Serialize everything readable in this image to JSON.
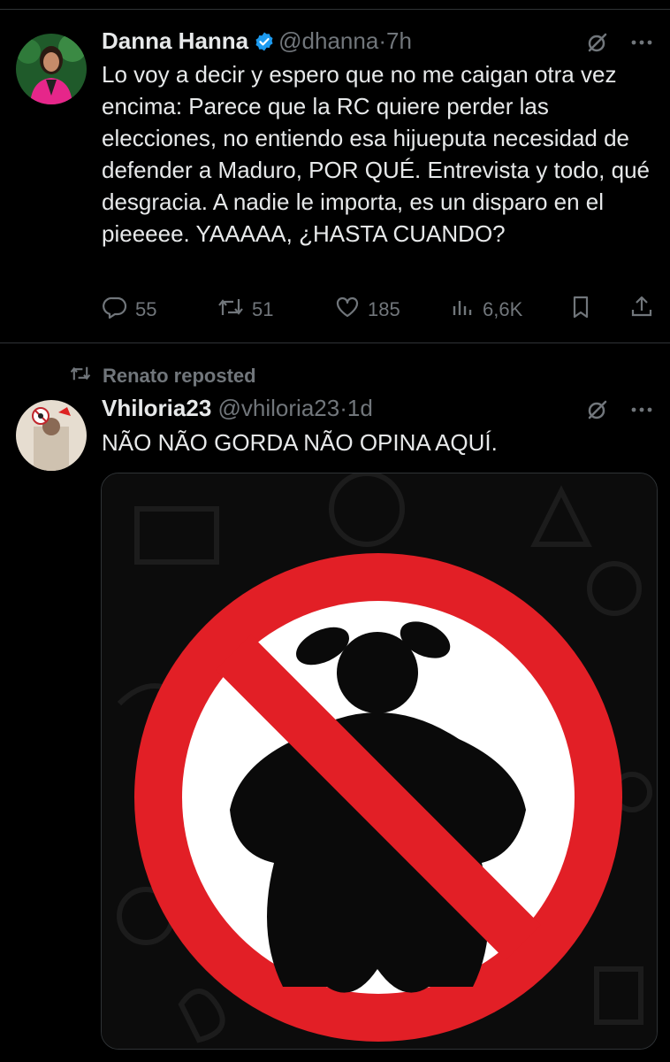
{
  "tweet1": {
    "name": "Danna Hanna",
    "handle": "@dhanna",
    "dot": "·",
    "time": "7h",
    "text": "Lo voy a decir y espero que no me caigan otra vez encima: Parece que la RC quiere perder las elecciones, no entiendo esa hijueputa necesidad de defender a Maduro, POR QUÉ. Entrevista y todo, qué desgracia. A nadie le importa, es un disparo en el pieeeee. YAAAAA, ¿HASTA CUANDO?",
    "actions": {
      "replies": "55",
      "reposts": "51",
      "likes": "185",
      "views": "6,6K"
    }
  },
  "tweet2": {
    "repost_label": "Renato reposted",
    "name": "Vhiloria23",
    "handle": "@vhiloria23",
    "dot": "·",
    "time": "1d",
    "text": "NÃO NÃO GORDA NÃO OPINA AQUÍ."
  },
  "colors": {
    "background": "#000000",
    "text": "#e7e9ea",
    "muted": "#71767b",
    "verified": "#1d9bf0",
    "prohibition_red": "#e21f26"
  }
}
